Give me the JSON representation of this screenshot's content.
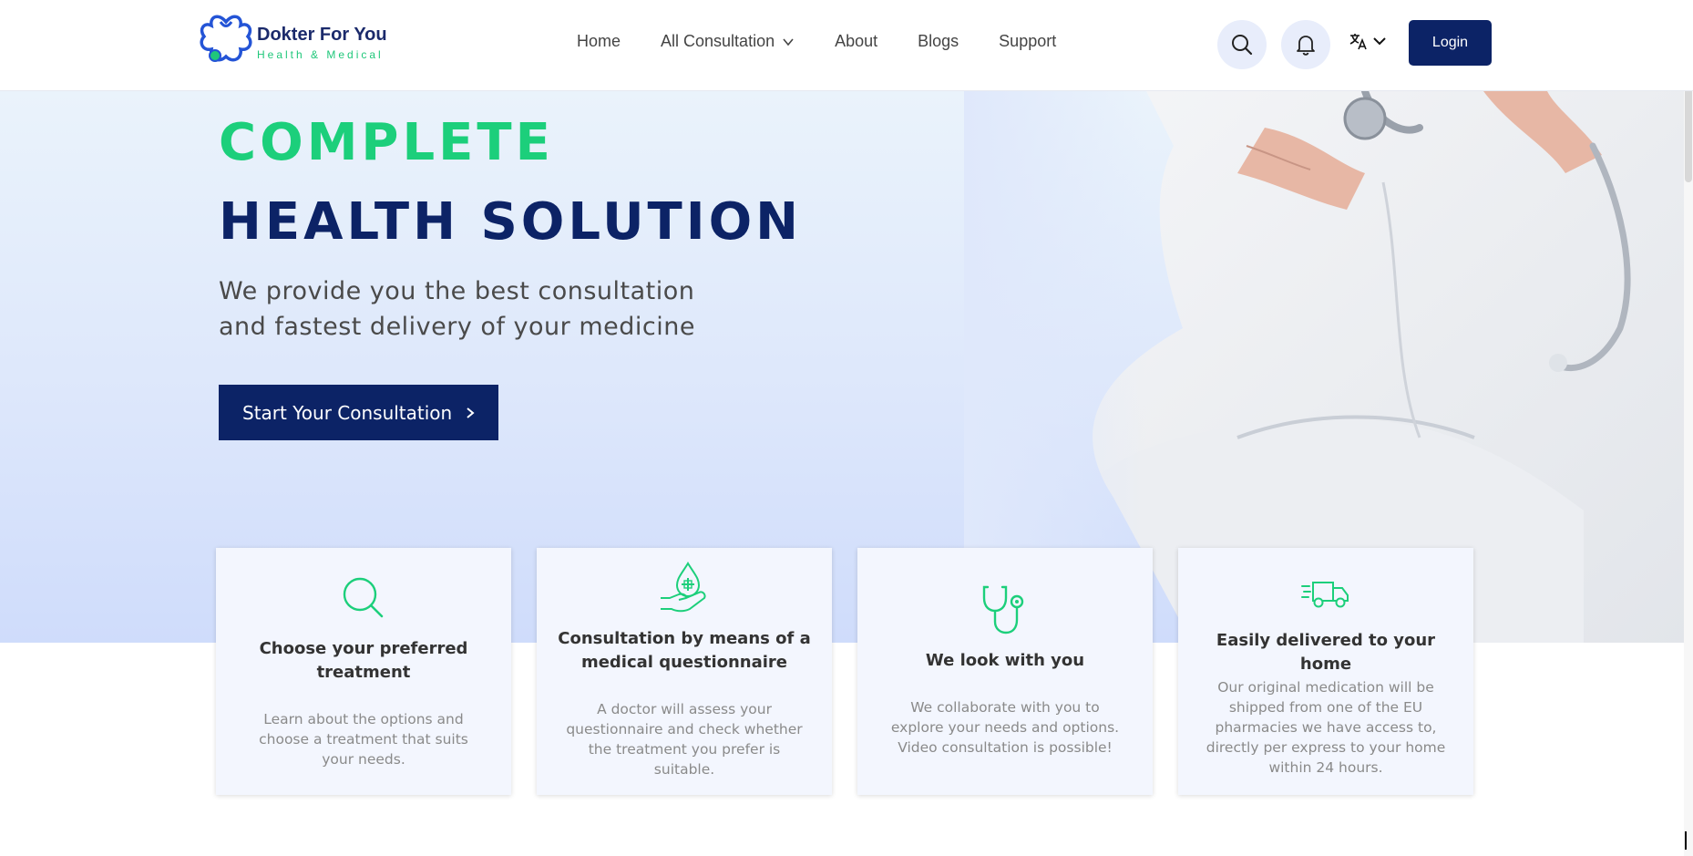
{
  "brand": {
    "name": "Dokter For You",
    "tagline": "Health & Medical"
  },
  "nav": {
    "items": [
      {
        "label": "Home"
      },
      {
        "label": "All Consultation",
        "has_dropdown": true
      },
      {
        "label": "About"
      },
      {
        "label": "Blogs"
      },
      {
        "label": "Support"
      }
    ]
  },
  "header_actions": {
    "search_icon": "search-icon",
    "notification_icon": "bell-icon",
    "language_icon": "translate-icon",
    "login_label": "Login"
  },
  "hero": {
    "title_line1": "COMPLETE",
    "title_line2": "HEALTH SOLUTION",
    "subtitle_line1": "We provide you the best consultation",
    "subtitle_line2": "and fastest delivery of your medicine",
    "cta_label": "Start Your Consultation",
    "cta_icon": "chevron-right-icon"
  },
  "features": [
    {
      "icon": "search-icon",
      "title_line1": "Choose your preferred",
      "title_line2": "treatment",
      "desc_lines": [
        "Learn about the options and",
        "choose a treatment that suits",
        "your needs."
      ]
    },
    {
      "icon": "hand-medicine-icon",
      "title_line1": "Consultation by means of a",
      "title_line2": "medical questionnaire",
      "desc_lines": [
        "A doctor will assess your",
        "questionnaire and check whether",
        "the treatment you prefer is",
        "suitable."
      ]
    },
    {
      "icon": "stethoscope-icon",
      "title_line1": "We look with you",
      "title_line2": "",
      "desc_lines": [
        "We collaborate with you to",
        "explore your needs and options.",
        "Video consultation is possible!"
      ]
    },
    {
      "icon": "delivery-truck-icon",
      "title_line1": "Easily delivered to your home",
      "title_line2": "",
      "desc_lines": [
        "Our original medication will be",
        "shipped from one of the EU",
        "pharmacies we have access to,",
        "directly per express to your home",
        "within 24 hours."
      ]
    }
  ],
  "colors": {
    "primary": "#0c2366",
    "accent": "#1ccf7b",
    "hero_bg": "#dde7fb",
    "card_bg": "#f3f6fe"
  }
}
